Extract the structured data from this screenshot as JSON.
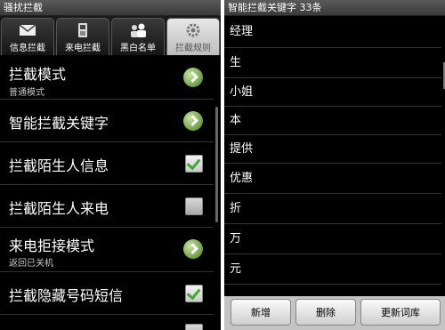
{
  "left": {
    "status_title": "骚扰拦截",
    "tabs": [
      {
        "label": "信息拦截",
        "icon": "envelope-icon"
      },
      {
        "label": "来电拦截",
        "icon": "phone-icon"
      },
      {
        "label": "黑白名单",
        "icon": "contacts-icon"
      },
      {
        "label": "拦截规则",
        "icon": "gear-icon"
      }
    ],
    "rows": [
      {
        "title": "拦截模式",
        "sub": "普通模式",
        "control": "chevron"
      },
      {
        "title": "智能拦截关键字",
        "control": "chevron"
      },
      {
        "title": "拦截陌生人信息",
        "control": "check-on"
      },
      {
        "title": "拦截陌生人来电",
        "control": "check-off"
      },
      {
        "title": "来电拒接模式",
        "sub": "返回已关机",
        "control": "chevron"
      },
      {
        "title": "拦截隐藏号码短信",
        "control": "check-on"
      }
    ]
  },
  "right": {
    "status_title": "智能拦截关键字 33条",
    "keywords": [
      "经理",
      "生",
      "小姐",
      "本",
      "提供",
      "优惠",
      "折",
      "万",
      "元"
    ],
    "buttons": {
      "add": "新增",
      "delete": "删除",
      "update": "更新词库"
    }
  }
}
